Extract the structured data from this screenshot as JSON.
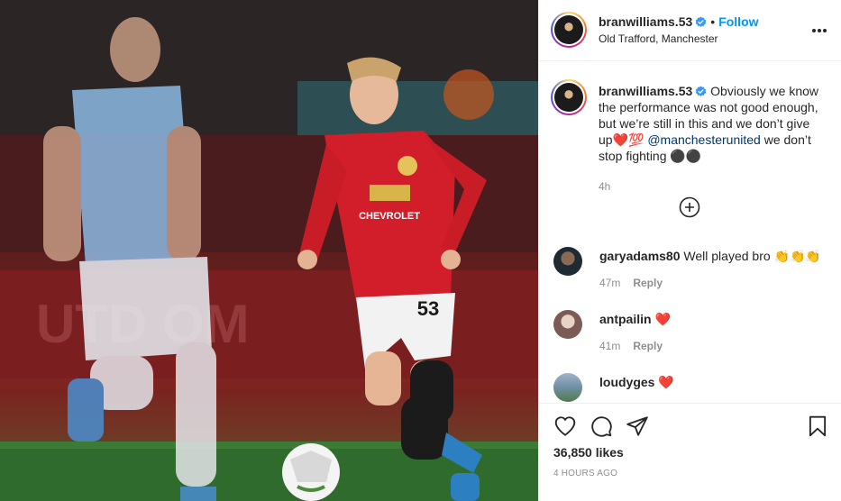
{
  "post": {
    "username": "branwilliams.53",
    "verified": true,
    "follow_label": "Follow",
    "location": "Old Trafford, Manchester",
    "more_label": "•••"
  },
  "photo": {
    "shirt_text": "CHEVROLET",
    "shorts_number": "53",
    "banner_text": "UTD OM"
  },
  "caption": {
    "username": "branwilliams.53",
    "text_before_mention": " Obviously we know the performance was not good enough, but we’re still in this and we don’t give up❤️💯 ",
    "mention": "@manchesterunited",
    "text_after_mention": " we don’t stop fighting ⚫⚫",
    "time": "4h"
  },
  "comments": [
    {
      "username": "garyadams80",
      "text": " Well played bro 👏👏👏",
      "time": "47m",
      "reply_label": "Reply"
    },
    {
      "username": "antpailin",
      "text": " ❤️",
      "time": "41m",
      "reply_label": "Reply"
    },
    {
      "username": "loudyges",
      "text": " ❤️",
      "time": "",
      "reply_label": ""
    }
  ],
  "actions": {
    "likes": "36,850 likes",
    "posted": "4 HOURS AGO"
  },
  "icons": {
    "like": "heart-icon",
    "comment": "comment-icon",
    "share": "share-icon",
    "save": "bookmark-icon",
    "load_more": "plus-circle-icon",
    "verified": "verified-badge-icon"
  },
  "colors": {
    "follow_blue": "#0095f6",
    "verified_blue": "#3897f0",
    "mention_blue": "#00376b",
    "muted_text": "#8e8e8e"
  }
}
